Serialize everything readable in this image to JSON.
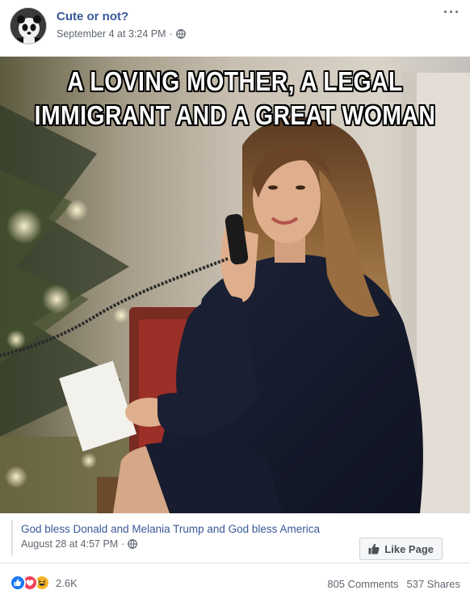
{
  "post": {
    "page_name": "Cute or not?",
    "timestamp": "September 4 at 3:24 PM",
    "timestamp_separator": "·",
    "more_menu": "···",
    "avatar_icon": "panda-avatar",
    "privacy_icon": "globe-icon"
  },
  "photo": {
    "caption_line1": "A LOVING MOTHER, A LEGAL",
    "caption_line2": "IMMIGRANT AND A GREAT WOMAN"
  },
  "shared": {
    "text": "God bless Donald and Melania Trump and God bless America",
    "timestamp": "August 28 at 4:57 PM",
    "timestamp_separator": "·",
    "like_page_label": "Like Page",
    "like_icon": "thumbs-up-icon"
  },
  "footer": {
    "reaction_icons": [
      "like-reaction-icon",
      "love-reaction-icon",
      "haha-reaction-icon"
    ],
    "reaction_count": "2.6K",
    "comments": "805 Comments",
    "shares": "537 Shares"
  },
  "colors": {
    "link_blue": "#385898",
    "meta_gray": "#606770",
    "like_blue": "#1877f2",
    "love_red": "#f33e58",
    "haha_yellow": "#f7b125"
  }
}
